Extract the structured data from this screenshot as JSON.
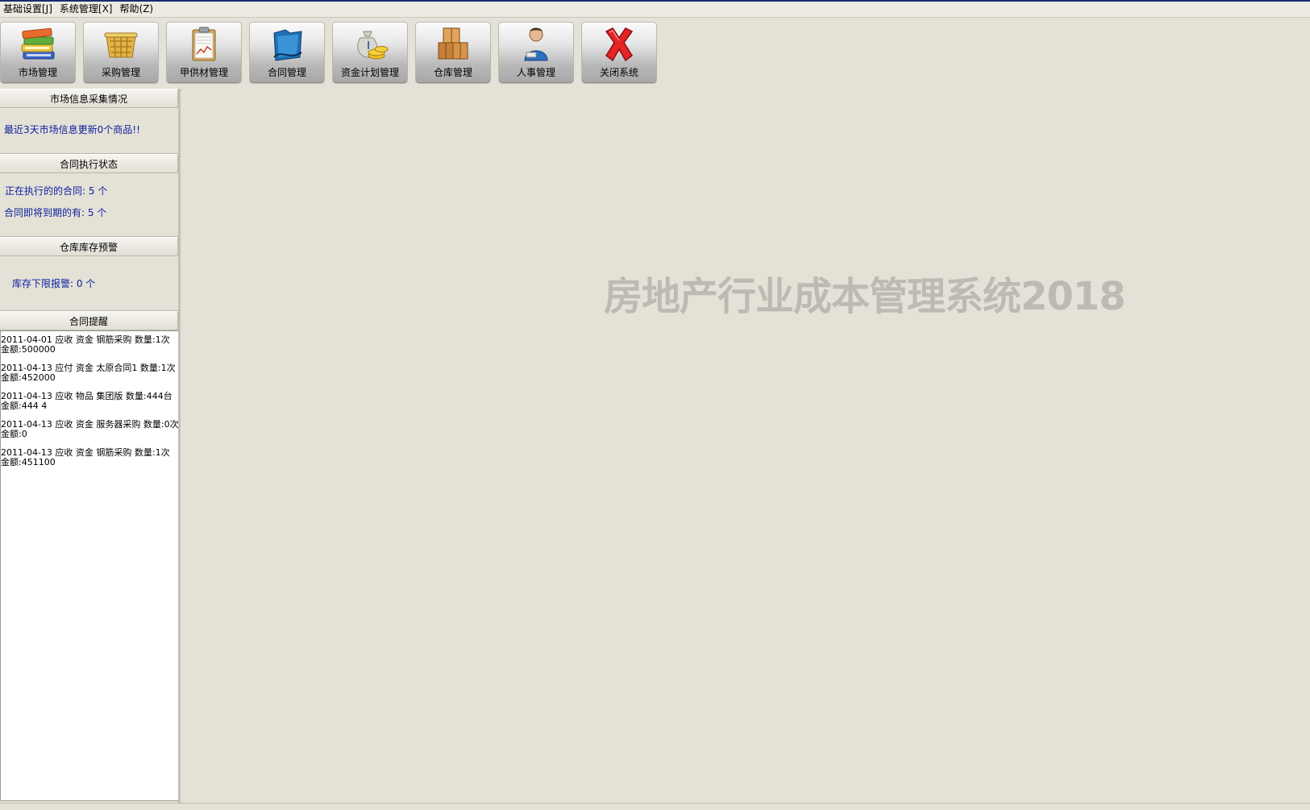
{
  "menu": [
    {
      "label": "基础设置[J]"
    },
    {
      "label": "系统管理[X]"
    },
    {
      "label": "帮助(Z)"
    }
  ],
  "toolbar": [
    {
      "label": "市场管理",
      "icon": "books-icon"
    },
    {
      "label": "采购管理",
      "icon": "basket-icon"
    },
    {
      "label": "甲供材管理",
      "icon": "clipboard-chart-icon"
    },
    {
      "label": "合同管理",
      "icon": "folder-icon"
    },
    {
      "label": "资金计划管理",
      "icon": "money-bag-icon"
    },
    {
      "label": "仓库管理",
      "icon": "boxes-icon"
    },
    {
      "label": "人事管理",
      "icon": "person-icon"
    },
    {
      "label": "关闭系统",
      "icon": "close-icon"
    }
  ],
  "panel": {
    "market": {
      "title": "市场信息采集情况",
      "text": "最近3天市场信息更新0个商品!!"
    },
    "contract_status": {
      "title": "合同执行状态",
      "executing": "正在执行的的合同: 5 个",
      "expiring": "合同即将到期的有: 5 个"
    },
    "warehouse": {
      "title": "仓库库存预警",
      "text": "库存下限报警:  0  个"
    },
    "reminders": {
      "title": "合同提醒",
      "items": [
        "2011-04-01 应收 资金 钢筋采购 数量:1次 金额:500000",
        "2011-04-13 应付 资金 太原合同1 数量:1次 金额:452000",
        "2011-04-13 应收 物品 集团版 数量:444台 金额:444 4",
        "2011-04-13 应收 资金 服务器采购 数量:0次 金额:0",
        "2011-04-13 应收 资金 钢筋采购 数量:1次 金额:451100"
      ]
    }
  },
  "main": {
    "watermark": "房地产行业成本管理系统2018"
  },
  "colors": {
    "background": "#e4e1d6",
    "info_text": "#0a1ea0",
    "watermark": "#bcbab3",
    "title_bar_line": "#1b2a6e"
  }
}
